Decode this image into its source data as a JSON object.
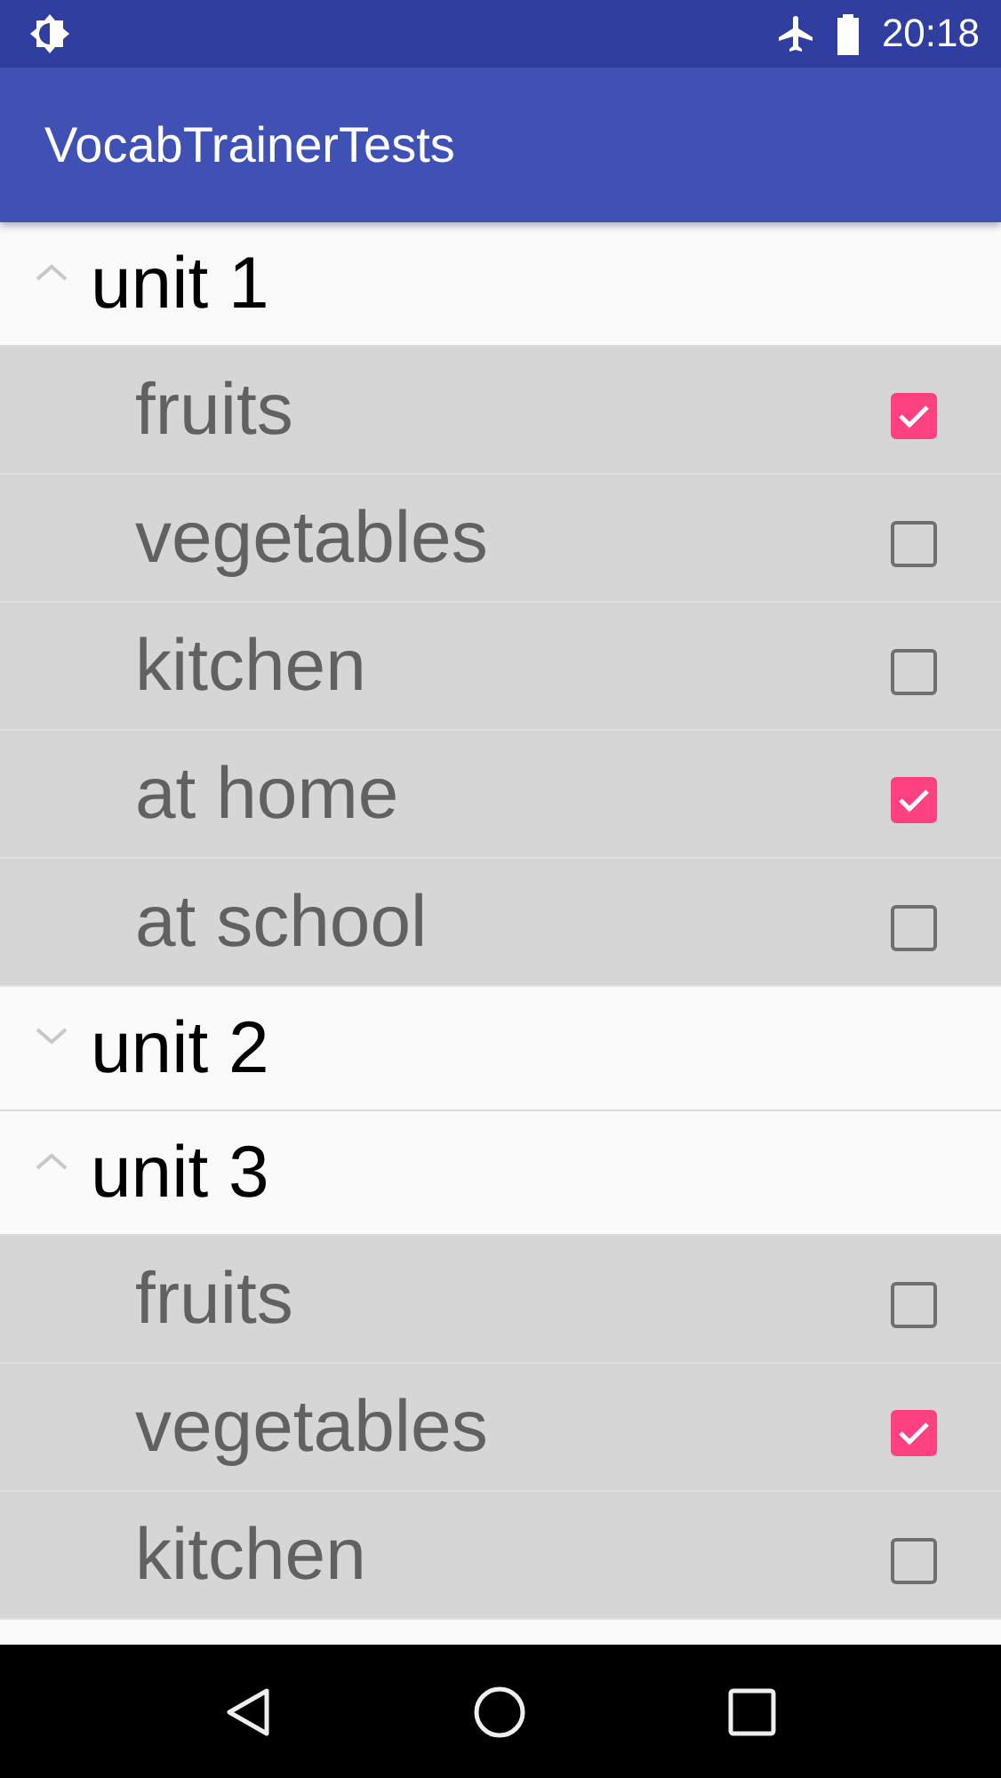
{
  "status_bar": {
    "time": "20:18"
  },
  "app_bar": {
    "title": "VocabTrainerTests"
  },
  "units": [
    {
      "label": "unit 1",
      "expanded": true,
      "topics": [
        {
          "label": "fruits",
          "checked": true
        },
        {
          "label": "vegetables",
          "checked": false
        },
        {
          "label": "kitchen",
          "checked": false
        },
        {
          "label": "at home",
          "checked": true
        },
        {
          "label": "at school",
          "checked": false
        }
      ]
    },
    {
      "label": "unit 2",
      "expanded": false
    },
    {
      "label": "unit 3",
      "expanded": true,
      "topics": [
        {
          "label": "fruits",
          "checked": false
        },
        {
          "label": "vegetables",
          "checked": true
        },
        {
          "label": "kitchen",
          "checked": false
        }
      ]
    }
  ]
}
